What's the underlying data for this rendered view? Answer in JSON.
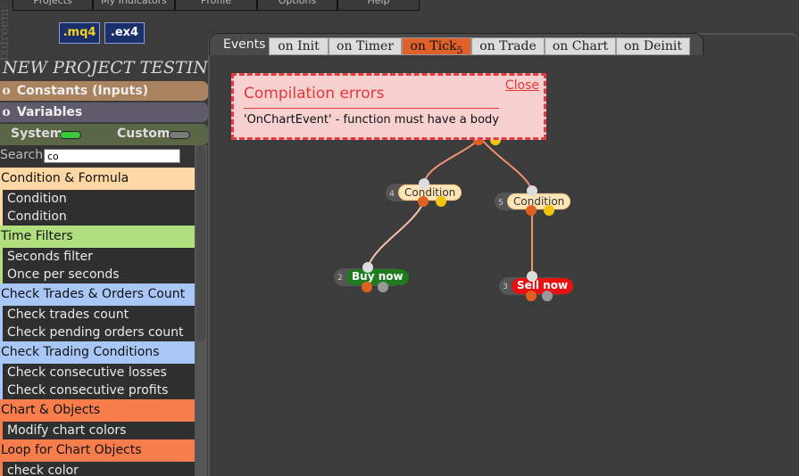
{
  "top_menu": [
    "Projects",
    "My Indicators",
    "Profile",
    "Options",
    "Help"
  ],
  "brand": "fxdreema",
  "file_buttons": {
    "mq4": ".mq4",
    "ex4": ".ex4"
  },
  "project_title": "NEW PROJECT TESTING",
  "sidebar": {
    "constants_label": "Constants (Inputs)",
    "variables_label": "Variables",
    "system_label": "System",
    "custom_label": "Custom",
    "search_label": "Search:",
    "search_value": "co"
  },
  "block_list": [
    {
      "category": "Condition & Formula",
      "color": "#fdd8a4",
      "items": [
        "Condition",
        "Condition"
      ]
    },
    {
      "category": "Time Filters",
      "color": "#b1df7d",
      "items": [
        "Seconds filter",
        "Once per seconds"
      ]
    },
    {
      "category": "Check Trades & Orders Count",
      "color": "#a9c7f6",
      "items": [
        "Check trades count",
        "Check pending orders count"
      ]
    },
    {
      "category": "Check Trading Conditions",
      "color": "#a9c7f6",
      "items": [
        "Check consecutive losses",
        "Check consecutive profits"
      ]
    },
    {
      "category": "Chart & Objects",
      "color": "#f77d4c",
      "items": [
        "Modify chart colors"
      ]
    },
    {
      "category": "Loop for Chart Objects",
      "color": "#f77d4c",
      "items": [
        "check color"
      ]
    }
  ],
  "events": {
    "label": "Events",
    "tabs": [
      "on Init",
      "on Timer",
      "on Tick",
      "on Trade",
      "on Chart",
      "on Deinit"
    ],
    "active": "on Tick",
    "active_badge": "5"
  },
  "error_popup": {
    "title": "Compilation errors",
    "message": "'OnChartEvent' - function must have a body",
    "close_label": "Close"
  },
  "nodes": [
    {
      "id": "4",
      "label": "Condition"
    },
    {
      "id": "5",
      "label": "Condition"
    },
    {
      "id": "2",
      "label": "Buy now"
    },
    {
      "id": "3",
      "label": "Sell now"
    }
  ],
  "colors": {
    "accent": "#e0622a",
    "error": "#e33838",
    "buy": "#1e7b1e",
    "sell": "#e81010"
  }
}
